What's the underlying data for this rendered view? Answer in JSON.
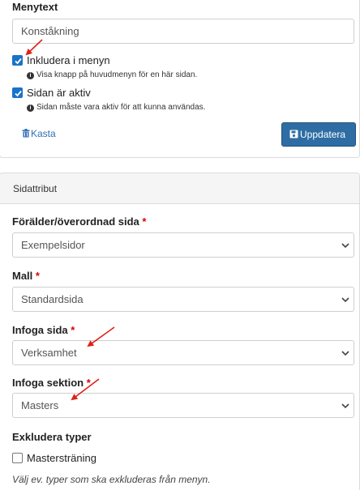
{
  "menu": {
    "label": "Menytext",
    "value": "Konståkning",
    "include_label": "Inkludera i menyn",
    "include_help": "Visa knapp på huvudmenyn för en här sidan.",
    "include_checked": true,
    "active_label": "Sidan är aktiv",
    "active_help": "Sidan måste vara aktiv för att kunna användas.",
    "active_checked": true,
    "discard_label": "Kasta",
    "update_label": "Uppdatera"
  },
  "attributes": {
    "header": "Sidattribut",
    "parent_label": "Förälder/överordnad sida",
    "parent_value": "Exempelsidor",
    "template_label": "Mall",
    "template_value": "Standardsida",
    "insert_page_label": "Infoga sida",
    "insert_page_value": "Verksamhet",
    "insert_section_label": "Infoga sektion",
    "insert_section_value": "Masters",
    "required_mark": "*",
    "exclude_label": "Exkludera typer",
    "exclude_option": "Mastersträning",
    "exclude_checked": false,
    "exclude_help": "Välj ev. typer som ska exkluderas från menyn."
  },
  "icons": {
    "info": "info-circle-icon",
    "trash": "trash-icon",
    "save": "save-icon",
    "chevron": "chevron-down-icon",
    "annotation": "red-arrow-annotation"
  },
  "colors": {
    "primary_button": "#2e6da4",
    "checkbox": "#1a73c8",
    "link": "#2f6fb4",
    "required": "#d9000d",
    "annotation_arrow": "#e0201a"
  }
}
